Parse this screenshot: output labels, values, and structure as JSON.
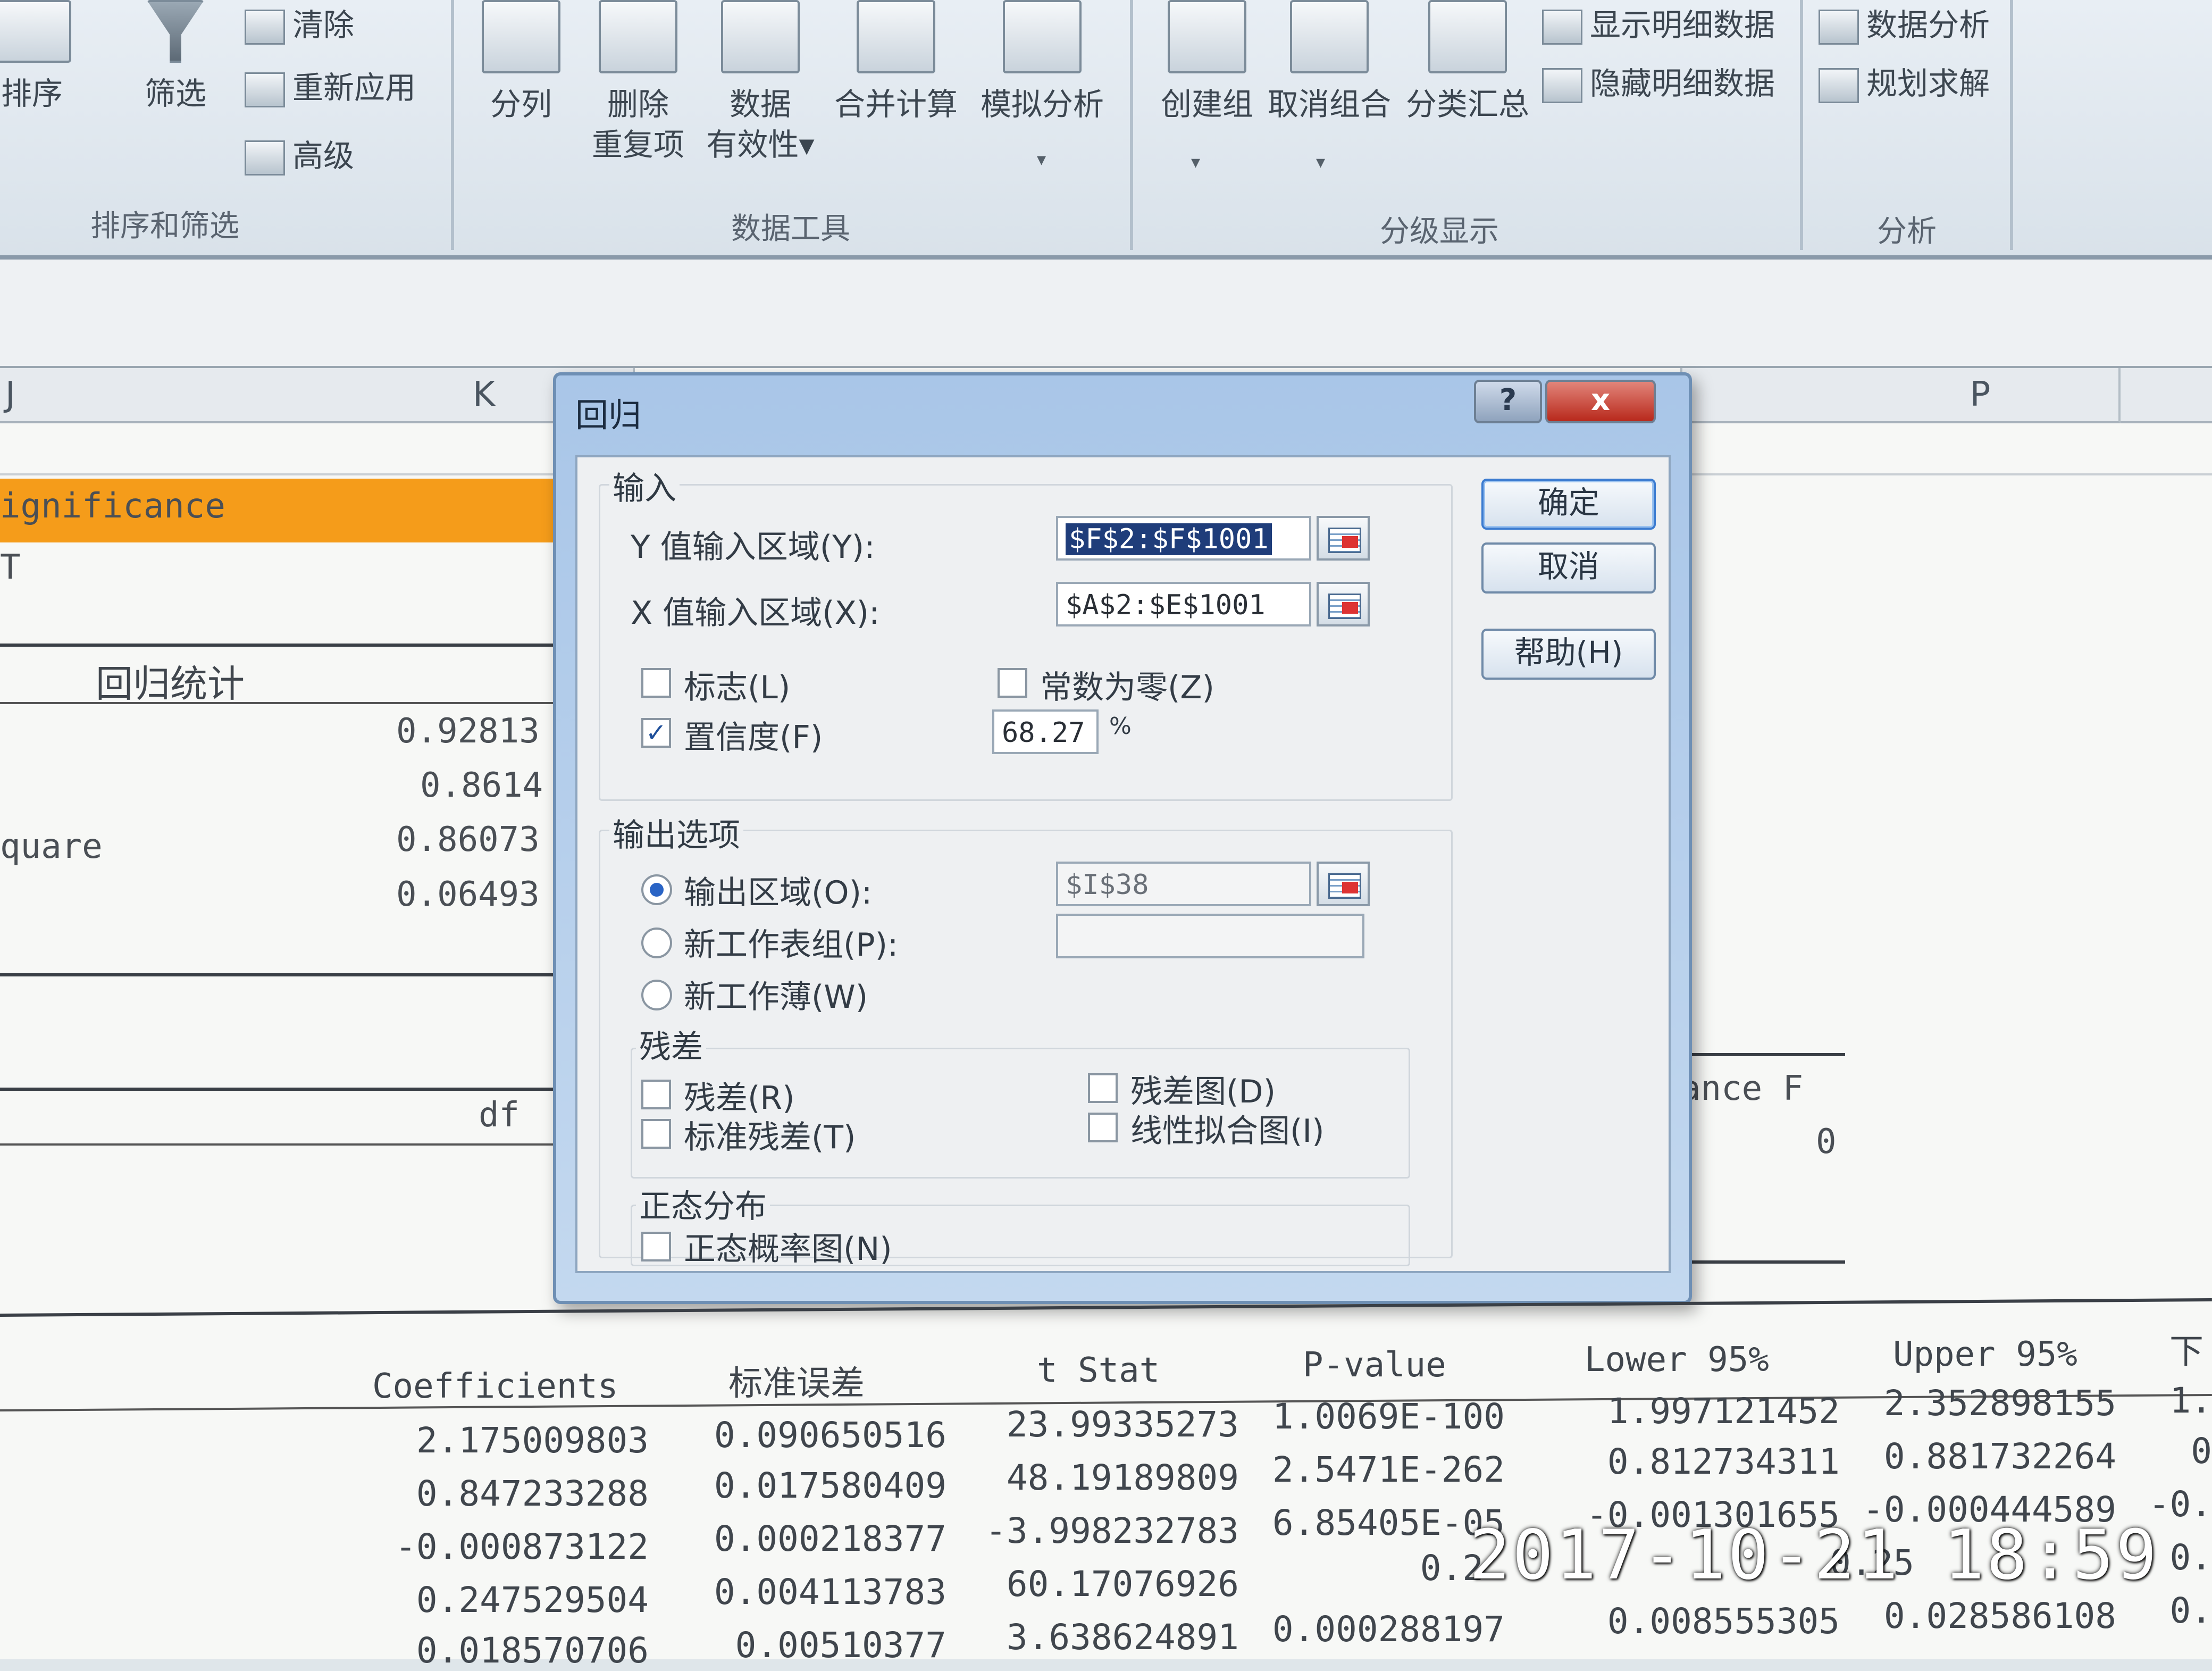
{
  "ribbon": {
    "sort_filter": {
      "az_icon": "az-sort-icon",
      "sort": "排序",
      "filter": "筛选",
      "clear": "清除",
      "reapply": "重新应用",
      "advanced": "高级",
      "group_label": "排序和筛选"
    },
    "data_tools": {
      "split": "分列",
      "remove_dup_1": "删除",
      "remove_dup_2": "重复项",
      "validation_1": "数据",
      "validation_2": "有效性",
      "consolidate": "合并计算",
      "whatif": "模拟分析",
      "group_label": "数据工具",
      "dropdown": "▾"
    },
    "outline": {
      "group": "创建组",
      "ungroup": "取消组合",
      "subtotal": "分类汇总",
      "show_detail": "显示明细数据",
      "hide_detail": "隐藏明细数据",
      "group_label": "分级显示",
      "dropdown": "▾"
    },
    "analysis": {
      "data_analysis": "数据分析",
      "solver": "规划求解",
      "group_label": "分析"
    }
  },
  "sheet": {
    "columns": [
      "J",
      "K",
      "P"
    ],
    "sig_text": "ignificance",
    "t_text": "T",
    "regression_stats_title": "回归统计",
    "stat_values": [
      "0.92813",
      "0.8614",
      "0.86073",
      "0.06493"
    ],
    "square_label": "quare",
    "df_label": "df",
    "ance_f_label": "ance F",
    "ance_f_value": "0"
  },
  "dialog": {
    "title": "回归",
    "help_icon": "?",
    "close_icon": "x",
    "input_group": "输入",
    "y_label": "Y 值输入区域(Y):",
    "y_value": "$F$2:$F$1001",
    "x_label": "X 值输入区域(X):",
    "x_value": "$A$2:$E$1001",
    "labels_cb": "标志(L)",
    "const_zero_cb": "常数为零(Z)",
    "confidence_cb": "置信度(F)",
    "confidence_value": "68.27",
    "percent": "%",
    "output_group": "输出选项",
    "output_range": "输出区域(O):",
    "output_range_value": "$I$38",
    "new_sheet": "新工作表组(P):",
    "new_book": "新工作薄(W)",
    "residual_group": "残差",
    "residuals": "残差(R)",
    "std_residuals": "标准残差(T)",
    "residual_plots": "残差图(D)",
    "line_fit": "线性拟合图(I)",
    "normal_group": "正态分布",
    "normal_plot": "正态概率图(N)",
    "ok": "确定",
    "cancel": "取消",
    "help": "帮助(H)",
    "states": {
      "labels": false,
      "const_zero": false,
      "confidence": true,
      "output_selected": "output_range"
    }
  },
  "coef_table": {
    "headers": [
      "Coefficients",
      "标准误差",
      "t Stat",
      "P-value",
      "Lower 95%",
      "Upper 95%",
      "下"
    ],
    "rows": [
      [
        "2.175009803",
        "0.090650516",
        "23.99335273",
        "1.0069E-100",
        "1.997121452",
        "2.352898155",
        "1."
      ],
      [
        "0.847233288",
        "0.017580409",
        "48.19189809",
        "2.5471E-262",
        "0.812734311",
        "0.881732264",
        "0"
      ],
      [
        "-0.000873122",
        "0.000218377",
        "-3.998232783",
        "6.85405E-05",
        "-0.001301655",
        "-0.000444589",
        "-0."
      ],
      [
        "0.247529504",
        "0.004113783",
        "60.17076926",
        "",
        "0.2",
        "0.25",
        "0."
      ],
      [
        "0.018570706",
        "0.00510377",
        "3.638624891",
        "0.000288197",
        "0.008555305",
        "0.028586108",
        "0."
      ]
    ]
  },
  "timestamp": "2017-10-21 18:59"
}
